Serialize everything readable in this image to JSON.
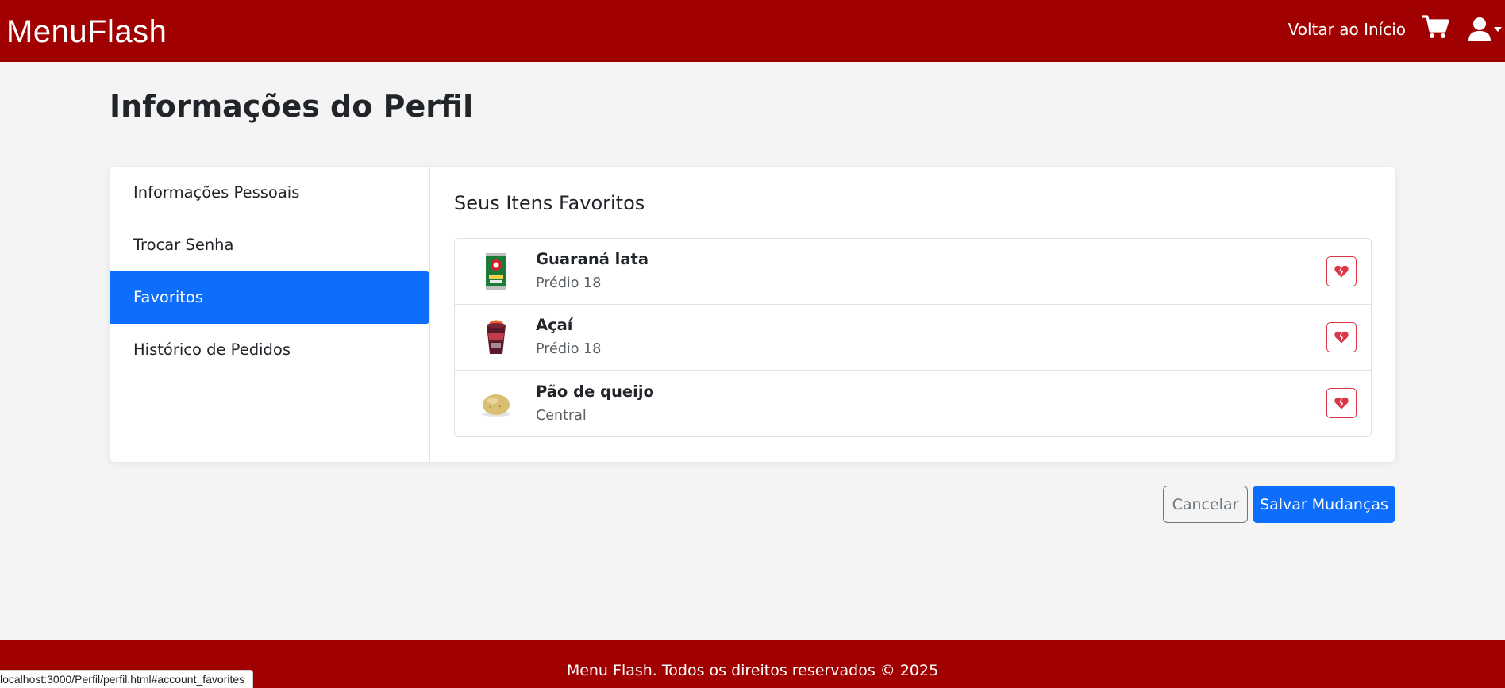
{
  "header": {
    "brand": "MenuFlash",
    "home_link": "Voltar ao Início",
    "cart_icon": "cart-icon",
    "user_icon": "user-icon",
    "brand_color": "#a10000"
  },
  "page": {
    "title": "Informações do Perfil"
  },
  "sidebar": {
    "items": [
      {
        "label": "Informações Pessoais",
        "active": false
      },
      {
        "label": "Trocar Senha",
        "active": false
      },
      {
        "label": "Favoritos",
        "active": true
      },
      {
        "label": "Histórico de Pedidos",
        "active": false
      }
    ],
    "active_color": "#0d6efd"
  },
  "favorites": {
    "title": "Seus Itens Favoritos",
    "items": [
      {
        "name": "Guaraná lata",
        "location": "Prédio 18",
        "image": "guarana-can-image",
        "action_icon": "broken-heart-icon"
      },
      {
        "name": "Açaí",
        "location": "Prédio 18",
        "image": "acai-cup-image",
        "action_icon": "broken-heart-icon"
      },
      {
        "name": "Pão de queijo",
        "location": "Central",
        "image": "cheese-bread-image",
        "action_icon": "broken-heart-icon"
      }
    ]
  },
  "actions": {
    "cancel_label": "Cancelar",
    "save_label": "Salvar Mudanças"
  },
  "footer": {
    "text": "Menu Flash. Todos os direitos reservados © 2025"
  },
  "status_bar": {
    "url": "localhost:3000/Perfil/perfil.html#account_favorites"
  }
}
